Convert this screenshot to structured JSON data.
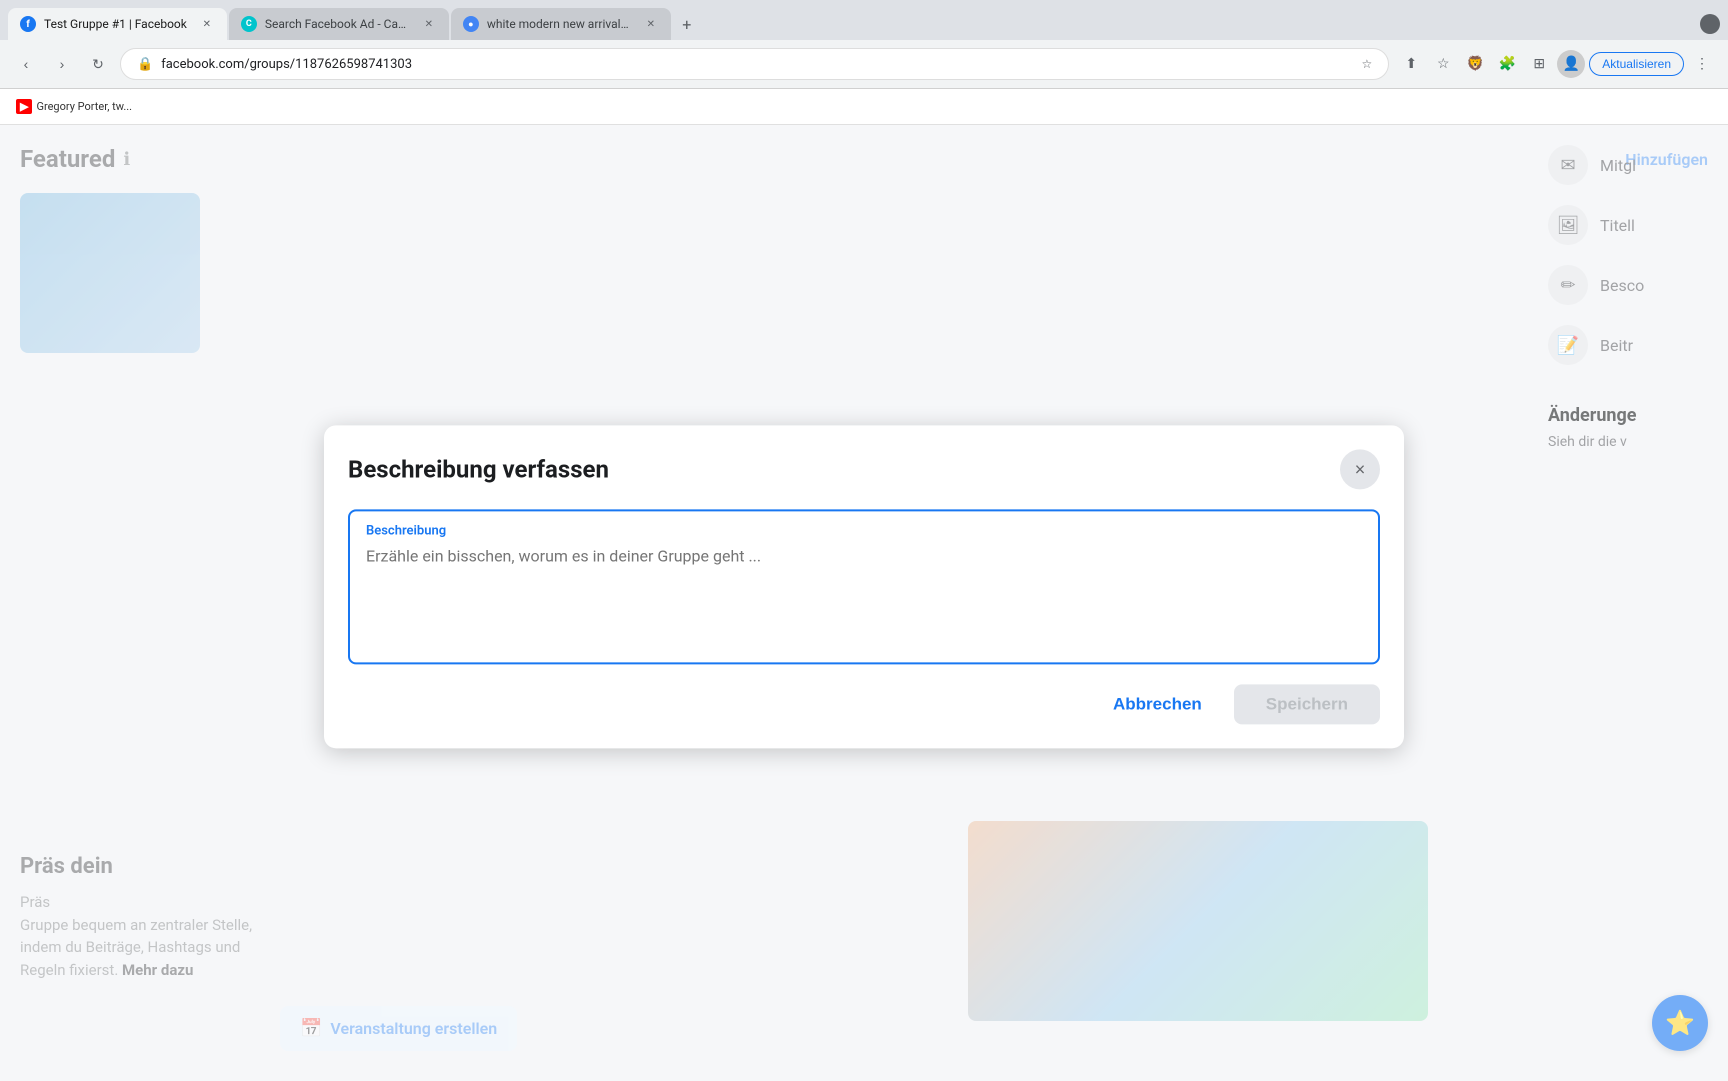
{
  "browser": {
    "tabs": [
      {
        "id": "tab1",
        "label": "Test Gruppe #1 | Facebook",
        "favicon": "fb",
        "active": true
      },
      {
        "id": "tab2",
        "label": "Search Facebook Ad - Canva",
        "favicon": "canva",
        "active": false
      },
      {
        "id": "tab3",
        "label": "white modern new arrival watc...",
        "favicon": "circle",
        "active": false
      }
    ],
    "url": "facebook.com/groups/1187626598741303",
    "update_button": "Aktualisieren"
  },
  "youtube_bar": {
    "text": "Gregory Porter, tw..."
  },
  "background": {
    "featured_label": "Featured",
    "hinzufugen_label": "Hinzufügen",
    "sidebar_items": [
      {
        "label": "Mitgl"
      },
      {
        "label": "Titell"
      },
      {
        "label": "Besco"
      },
      {
        "label": "Beitr"
      }
    ],
    "text_title": "Präs dein",
    "text_body_line1": "Präs",
    "text_body_line2": "Gruppe bequem an zentraler Stelle,",
    "text_body_line3": "indem du Beiträge, Hashtags und",
    "text_body_line4": "Regeln fixierst.",
    "text_link": "Mehr dazu",
    "anderungen_title": "Änderunge",
    "anderungen_text": "Sieh dir die v",
    "veranstaltung_label": "Veranstaltung erstellen"
  },
  "modal": {
    "title": "Beschreibung verfassen",
    "close_label": "×",
    "textarea_label": "Beschreibung",
    "textarea_placeholder": "Erzähle ein bisschen, worum es in deiner Gruppe geht ...",
    "cancel_label": "Abbrechen",
    "save_label": "Speichern"
  }
}
